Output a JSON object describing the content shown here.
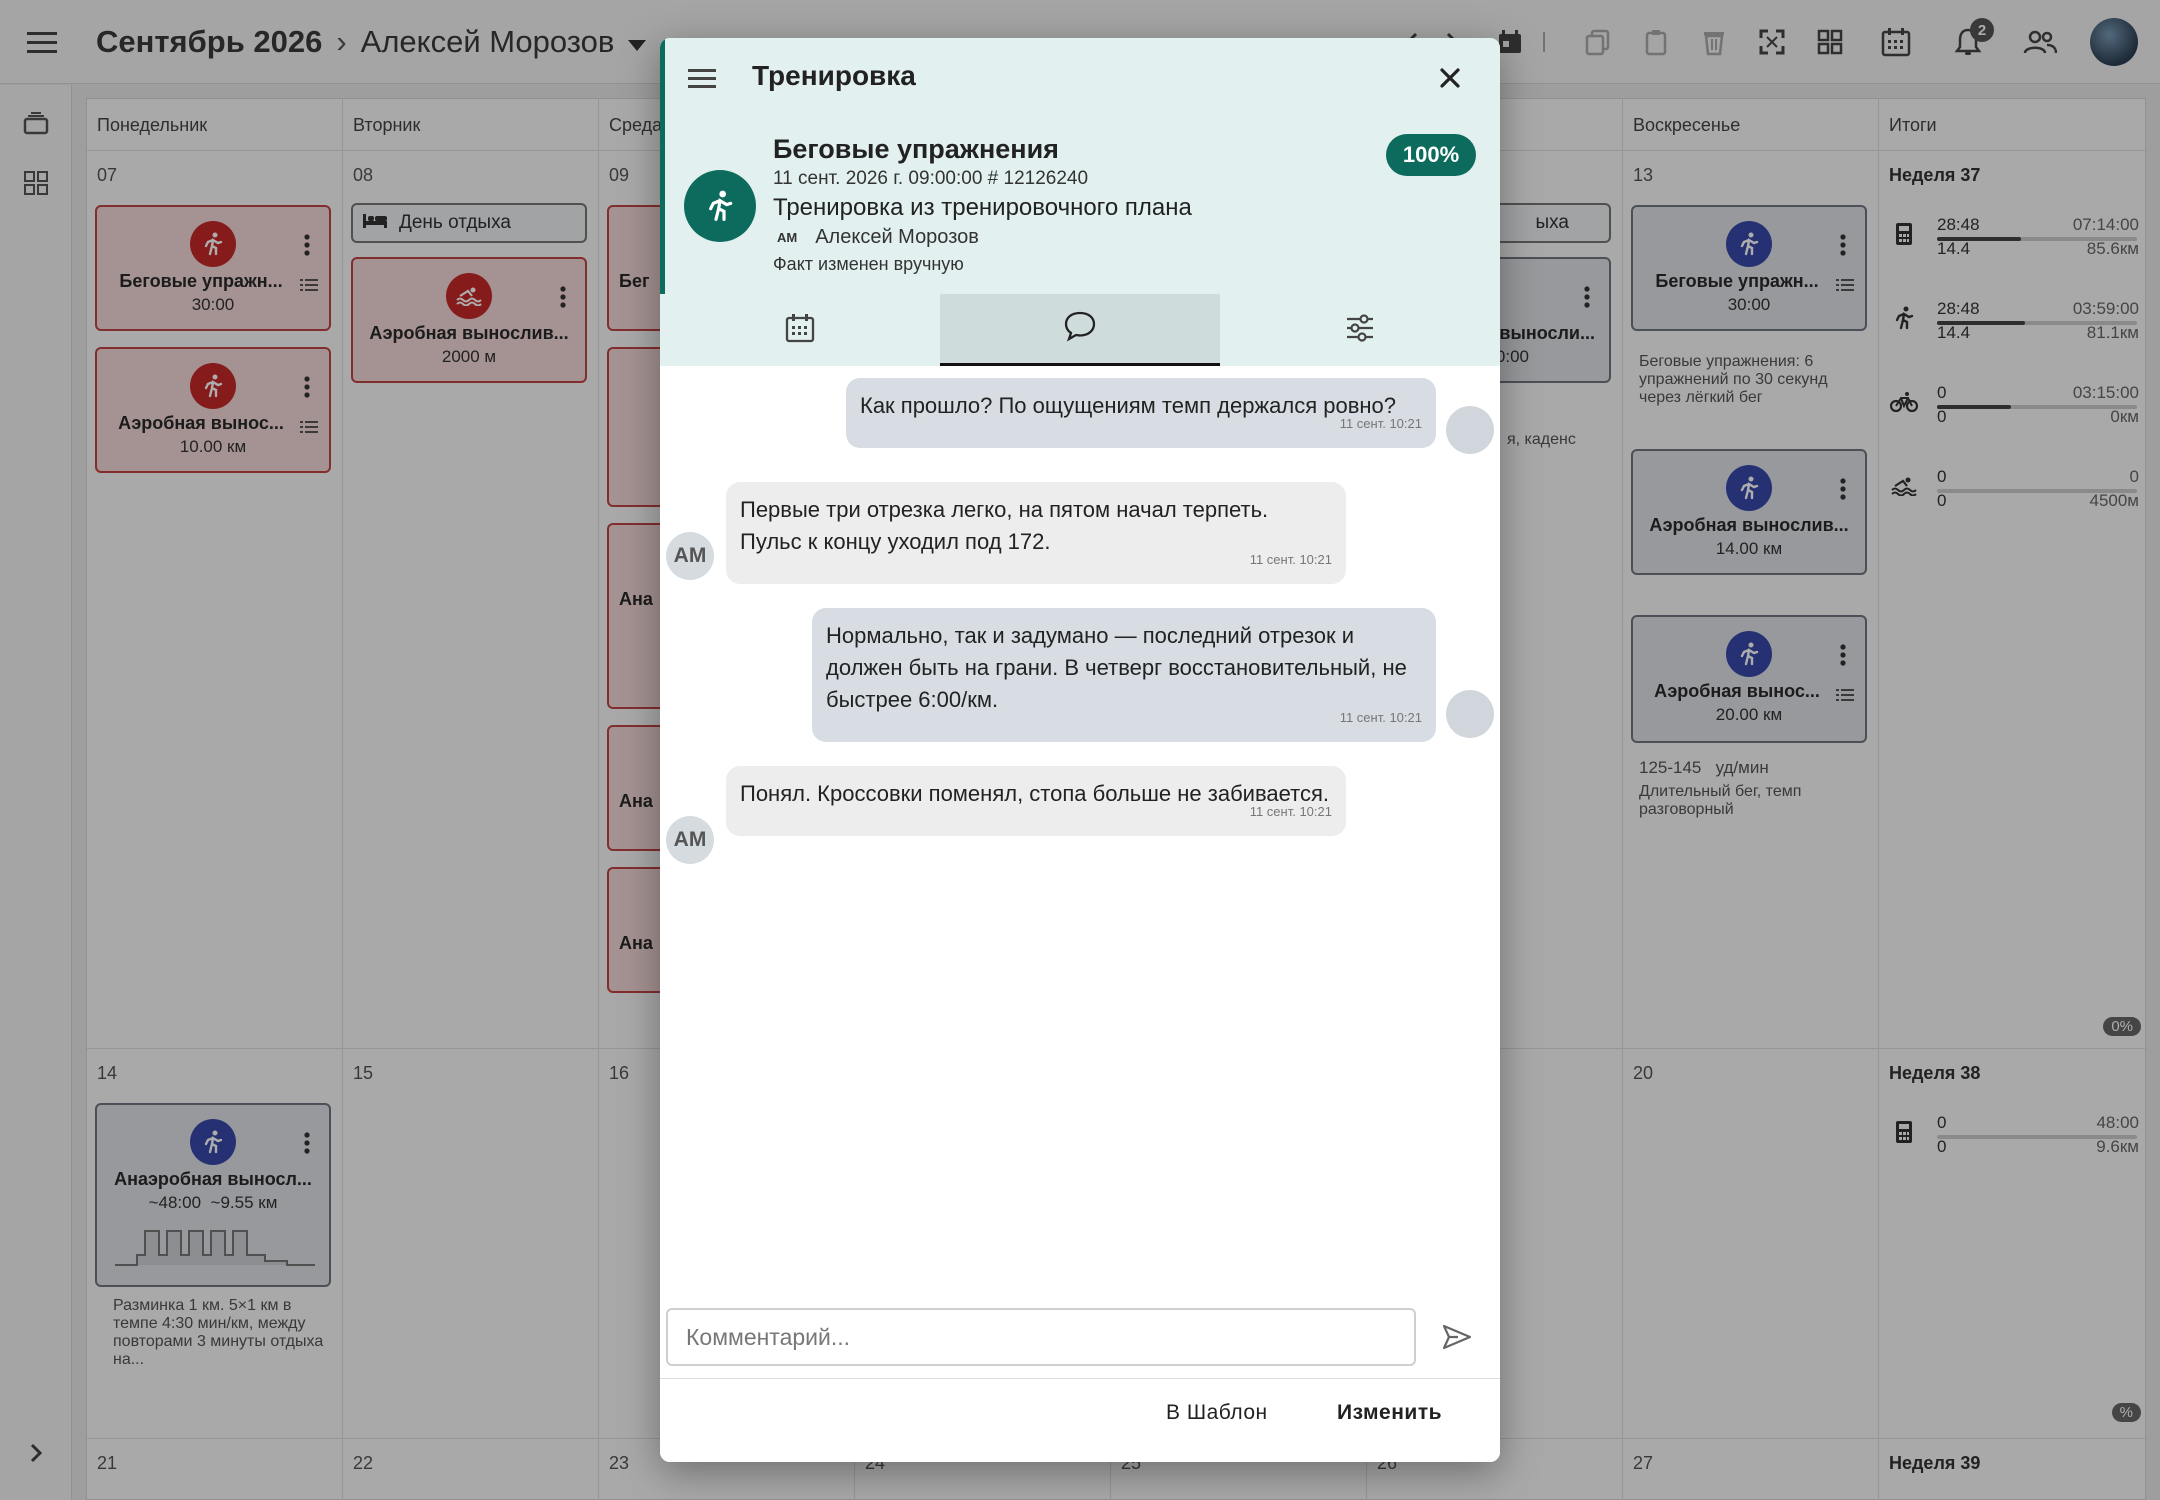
{
  "header": {
    "month": "Сентябрь 2026",
    "athlete": "Алексей Морозов",
    "notification_count": "2"
  },
  "calendar": {
    "columns": [
      "Понедельник",
      "Вторник",
      "Среда",
      "",
      "",
      "",
      "Воскресенье",
      "Итоги"
    ],
    "week1": {
      "days": [
        "07",
        "08",
        "09",
        "",
        "",
        "",
        "13"
      ],
      "mon_cards": [
        {
          "title": "Беговые упражн...",
          "sub": "30:00"
        },
        {
          "title": "Аэробная вынос...",
          "sub": "10.00 км"
        }
      ],
      "tue_rest": "День отдыха",
      "tue_card": {
        "title": "Аэробная вынослив...",
        "sub": "2000 м"
      },
      "wed_partials": [
        "Бег",
        "Ана",
        "Ана",
        "Ана"
      ],
      "sat_rest_partial": "ыха",
      "sat_card_partial": {
        "title": "выносли...",
        "sub": "0:00"
      },
      "sat_note_partial": "я, каденс",
      "sun_cards": [
        {
          "title": "Беговые упражн...",
          "sub": "30:00"
        },
        {
          "title": "Аэробная вынослив...",
          "sub": "14.00 км"
        },
        {
          "title": "Аэробная вынос...",
          "sub": "20.00 км"
        }
      ],
      "sun_note1": "Беговые упражнения: 6 упражнений по 30 секунд через лёгкий бег",
      "sun_hr": "125-145",
      "sun_hr_unit": "уд/мин",
      "sun_note2": "Длительный бег, темп разговорный",
      "summary": {
        "label": "Неделя 37",
        "rows": [
          {
            "icon": "calculator-icon",
            "v1": "28:48",
            "v2": "14.4",
            "r1": "07:14:00",
            "r2": "85.6км",
            "fill": 0.42
          },
          {
            "icon": "run-icon",
            "v1": "28:48",
            "v2": "14.4",
            "r1": "03:59:00",
            "r2": "81.1км",
            "fill": 0.44
          },
          {
            "icon": "bike-icon",
            "v1": "0",
            "v2": "0",
            "r1": "03:15:00",
            "r2": "0км",
            "fill": 0.37
          },
          {
            "icon": "swim-icon",
            "v1": "0",
            "v2": "0",
            "r1": "0",
            "r2": "4500м",
            "fill": 0
          }
        ],
        "pct": "0%"
      }
    },
    "week2": {
      "days": [
        "14",
        "15",
        "16",
        "",
        "",
        "",
        "20"
      ],
      "mon_card": {
        "title": "Анаэробная выносл...",
        "sub1": "~48:00",
        "sub2": "~9.55 км"
      },
      "mon_note": "Разминка 1 км. 5×1 км в темпе 4:30 мин/км, между повторами 3 минуты отдыха на...",
      "summary": {
        "label": "Неделя 38",
        "row": {
          "v1": "0",
          "v2": "0",
          "r1": "48:00",
          "r2": "9.6км"
        },
        "pct": "%"
      }
    },
    "week3": {
      "days": [
        "21",
        "22",
        "23",
        "24",
        "25",
        "26",
        "27"
      ],
      "summary_label": "Неделя 39"
    }
  },
  "dialog": {
    "title": "Тренировка",
    "workout_name": "Беговые упражнения",
    "meta": "11 сент. 2026 г. 09:00:00 # 12126240",
    "plan": "Тренировка из тренировочного плана",
    "athlete_initials": "AM",
    "athlete_name": "Алексей Морозов",
    "fact_note": "Факт изменен вручную",
    "completion": "100%",
    "tabs": [
      "calendar-icon",
      "comments-icon",
      "settings-sliders-icon"
    ],
    "messages": [
      {
        "dir": "out",
        "text": "Как прошло? По ощущениям темп держался ровно?",
        "time": "11 сент. 10:21"
      },
      {
        "dir": "in",
        "author": "AM",
        "text": "Первые три отрезка легко, на пятом начал терпеть. Пульс к концу уходил под 172.",
        "time": "11 сент. 10:21"
      },
      {
        "dir": "out",
        "text": "Нормально, так и задумано — последний отрезок и должен быть на грани. В четверг восстановительный, не быстрее 6:00/км.",
        "time": "11 сент. 10:21"
      },
      {
        "dir": "in",
        "author": "AM",
        "text": "Понял. Кроссовки поменял, стопа больше не забивается.",
        "time": "11 сент. 10:21"
      }
    ],
    "comment_placeholder": "Комментарий...",
    "btn_template": "В Шаблон",
    "btn_edit": "Изменить"
  },
  "colors": {
    "accent": "#0d6b5d",
    "dialog_header": "#e2f0f0",
    "card_red": "#c62828",
    "card_blue": "#3949ab"
  }
}
